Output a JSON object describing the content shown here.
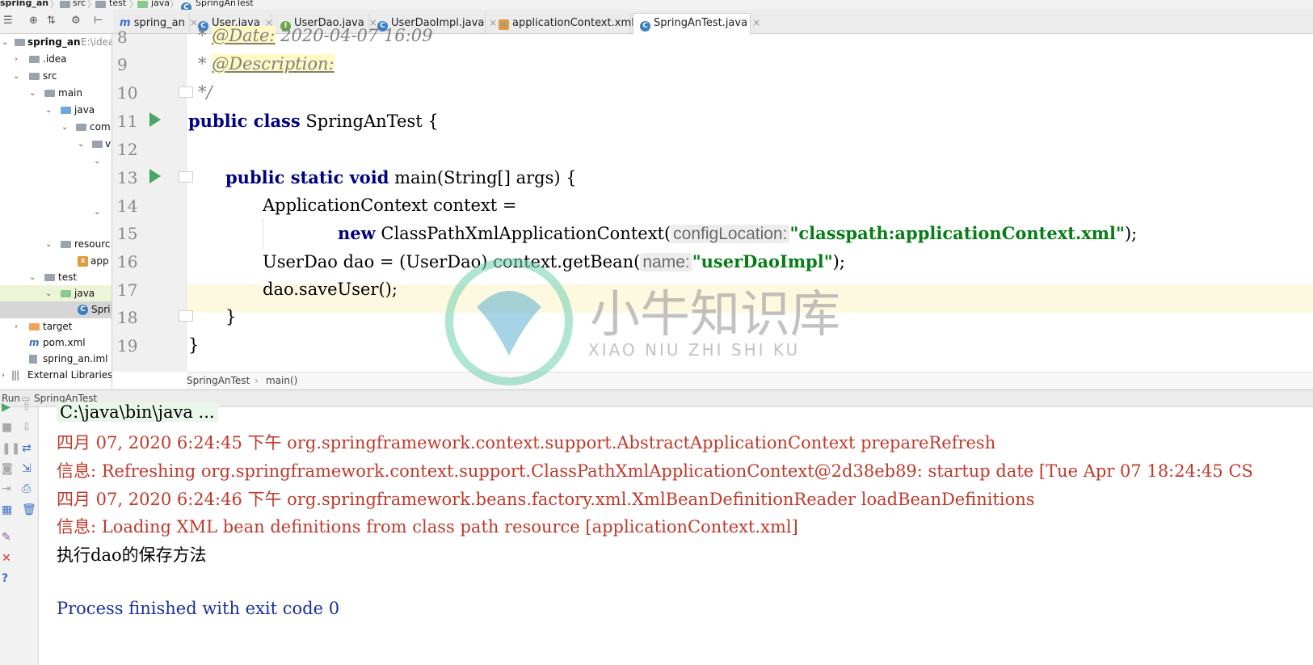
{
  "breadcrumb": [
    "spring_an",
    "src",
    "test",
    "java",
    "SpringAnTest"
  ],
  "tabs": [
    {
      "label": "spring_an",
      "icon": "maven-icon",
      "active": false
    },
    {
      "label": "User.java",
      "icon": "class-icon",
      "active": false
    },
    {
      "label": "UserDao.java",
      "icon": "interface-icon",
      "active": false
    },
    {
      "label": "UserDaoImpl.java",
      "icon": "class-icon",
      "active": false
    },
    {
      "label": "applicationContext.xml",
      "icon": "xml-icon",
      "active": false
    },
    {
      "label": "SpringAnTest.java",
      "icon": "class-icon",
      "active": true
    }
  ],
  "tree": {
    "root_label": "spring_an",
    "root_path": "E:\\idea",
    "items": [
      ".idea",
      "src",
      "main",
      "java",
      "com",
      "v",
      "resourc",
      "app",
      "test",
      "java",
      "Spri",
      "target",
      "pom.xml",
      "spring_an.iml",
      "External Libraries"
    ]
  },
  "editor": {
    "line_numbers": [
      "8",
      "9",
      "10",
      "11",
      "12",
      "13",
      "14",
      "15",
      "16",
      "17",
      "18",
      "19"
    ],
    "line8_prefix": "* ",
    "line8_tag": "@Date:",
    "line8_text": " 2020-04-07 16:09",
    "line9_prefix": "* ",
    "line9_tag": "@Description:",
    "line10": "*/",
    "line11_kw": "public class",
    "line11_rest": " SpringAnTest {",
    "line13_kw": "public static void",
    "line13_rest": " main(String[] args) {",
    "line14": "ApplicationContext context =",
    "line15_kw": "new",
    "line15_call": " ClassPathXmlApplicationContext(",
    "line15_hint": "configLocation:",
    "line15_str": "\"classpath:applicationContext.xml\"",
    "line15_end": ");",
    "line16_start": "UserDao dao  = (UserDao) context.getBean(",
    "line16_hint": "name:",
    "line16_str": "\"userDaoImpl\"",
    "line16_end": ");",
    "line17": "dao.saveUser();",
    "line18": "}",
    "line19": "}"
  },
  "editor_breadcrumb": {
    "class": "SpringAnTest",
    "method": "main()"
  },
  "run": {
    "label": "Run",
    "config": "SpringAnTest",
    "lines": [
      {
        "text": "C:\\java\\bin\\java ...",
        "style": "cmd"
      },
      {
        "text": "四月 07, 2020 6:24:45 下午 org.springframework.context.support.AbstractApplicationContext prepareRefresh",
        "style": "red"
      },
      {
        "text": "信息: Refreshing org.springframework.context.support.ClassPathXmlApplicationContext@2d38eb89: startup date [Tue Apr 07 18:24:45 CS",
        "style": "red"
      },
      {
        "text": "四月 07, 2020 6:24:46 下午 org.springframework.beans.factory.xml.XmlBeanDefinitionReader loadBeanDefinitions",
        "style": "red"
      },
      {
        "text": "信息: Loading XML bean definitions from class path resource [applicationContext.xml]",
        "style": "red"
      },
      {
        "text": "执行dao的保存方法",
        "style": "black"
      },
      {
        "text": "Process finished with exit code 0",
        "style": "blue"
      }
    ]
  },
  "watermark": {
    "title": "小牛知识库",
    "subtitle": "XIAO NIU ZHI SHI KU"
  },
  "colors": {
    "keyword": "#000080",
    "string": "#067d17",
    "run_green": "#4aa564",
    "console_red": "#c0392b",
    "console_blue": "#1a2f9e"
  }
}
